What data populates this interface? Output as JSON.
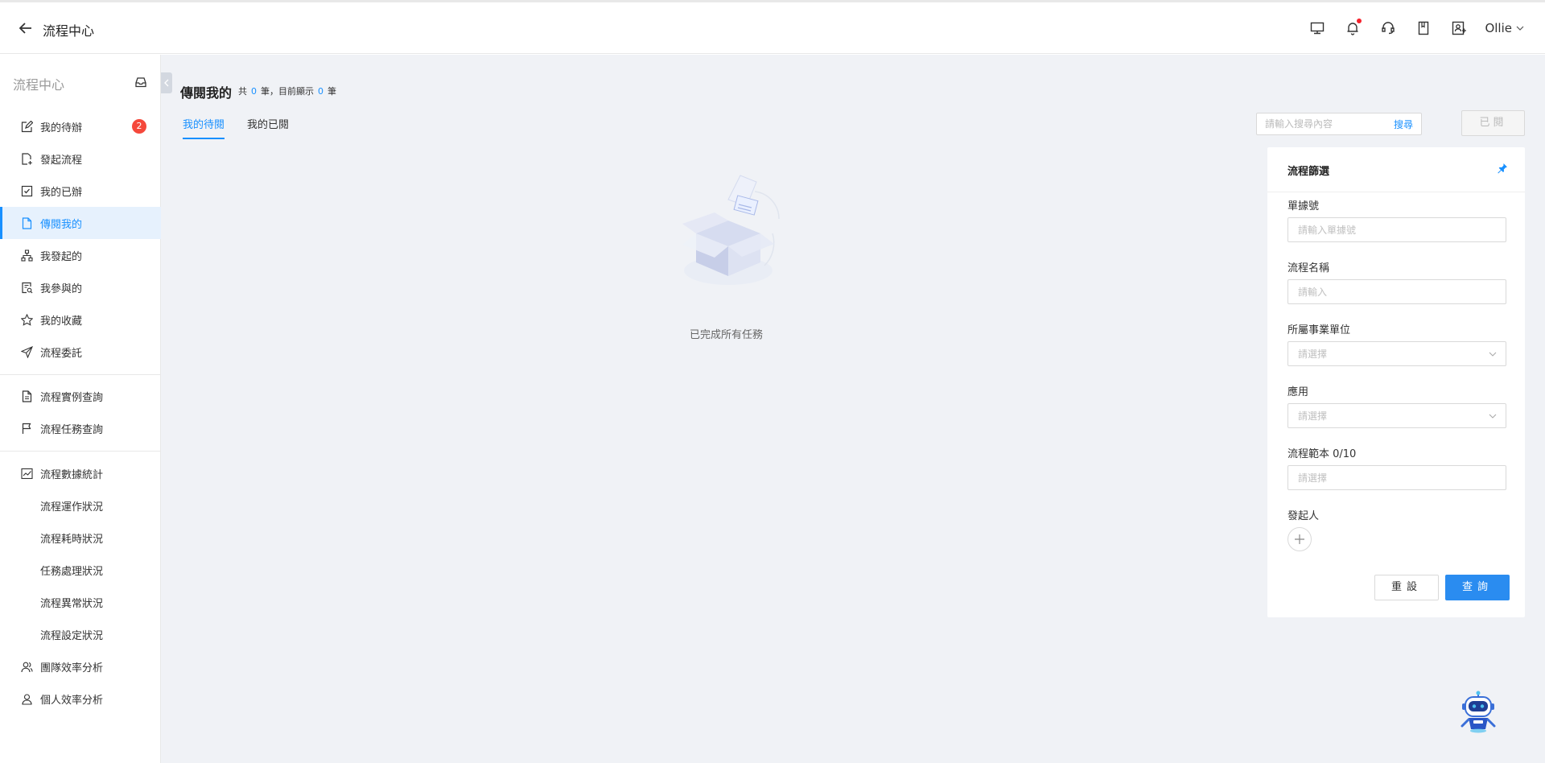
{
  "header": {
    "title": "流程中心",
    "user": "Ollie",
    "icons": [
      "monitor-icon",
      "bell-icon",
      "headset-icon",
      "book-icon",
      "user-switch-icon"
    ]
  },
  "sidebar": {
    "title": "流程中心",
    "items": [
      {
        "label": "我的待辦",
        "icon": "edit-icon",
        "badge": "2"
      },
      {
        "label": "發起流程",
        "icon": "file-add-icon"
      },
      {
        "label": "我的已辦",
        "icon": "checkbox-icon"
      },
      {
        "label": "傳閱我的",
        "icon": "file-icon"
      },
      {
        "label": "我發起的",
        "icon": "org-icon"
      },
      {
        "label": "我參與的",
        "icon": "file-search-icon"
      },
      {
        "label": "我的收藏",
        "icon": "star-icon"
      },
      {
        "label": "流程委託",
        "icon": "send-icon"
      },
      {
        "label": "流程實例查詢",
        "icon": "file-text-icon"
      },
      {
        "label": "流程任務查詢",
        "icon": "flag-icon"
      },
      {
        "label": "流程數據統計",
        "icon": "chart-icon"
      },
      {
        "label": "流程運作狀況"
      },
      {
        "label": "流程耗時狀況"
      },
      {
        "label": "任務處理狀況"
      },
      {
        "label": "流程異常狀況"
      },
      {
        "label": "流程設定狀況"
      },
      {
        "label": "團隊效率分析",
        "icon": "team-icon"
      },
      {
        "label": "個人效率分析",
        "icon": "user-icon"
      }
    ]
  },
  "main": {
    "title": "傳閱我的",
    "count_prefix": "共",
    "total": "0",
    "count_mid": "筆，目前顯示",
    "shown": "0",
    "count_suffix": "筆",
    "tabs": [
      "我的待閱",
      "我的已閱"
    ],
    "search_placeholder": "請輸入搜尋內容",
    "search_button": "搜尋",
    "read_button": "已閱",
    "empty_text": "已完成所有任務"
  },
  "filter": {
    "title": "流程篩選",
    "fields": [
      {
        "label": "單據號",
        "placeholder": "請輸入單據號"
      },
      {
        "label": "流程名稱",
        "placeholder": "請輸入"
      },
      {
        "label": "所屬事業單位",
        "placeholder": "請選擇"
      },
      {
        "label": "應用",
        "placeholder": "請選擇"
      },
      {
        "label": "流程範本 0/10",
        "placeholder": "請選擇"
      },
      {
        "label": "發起人"
      }
    ],
    "reset": "重設",
    "query": "查詢"
  },
  "colors": {
    "accent": "#1890ff",
    "badge": "#f5483b",
    "background": "#f0f2f6"
  }
}
